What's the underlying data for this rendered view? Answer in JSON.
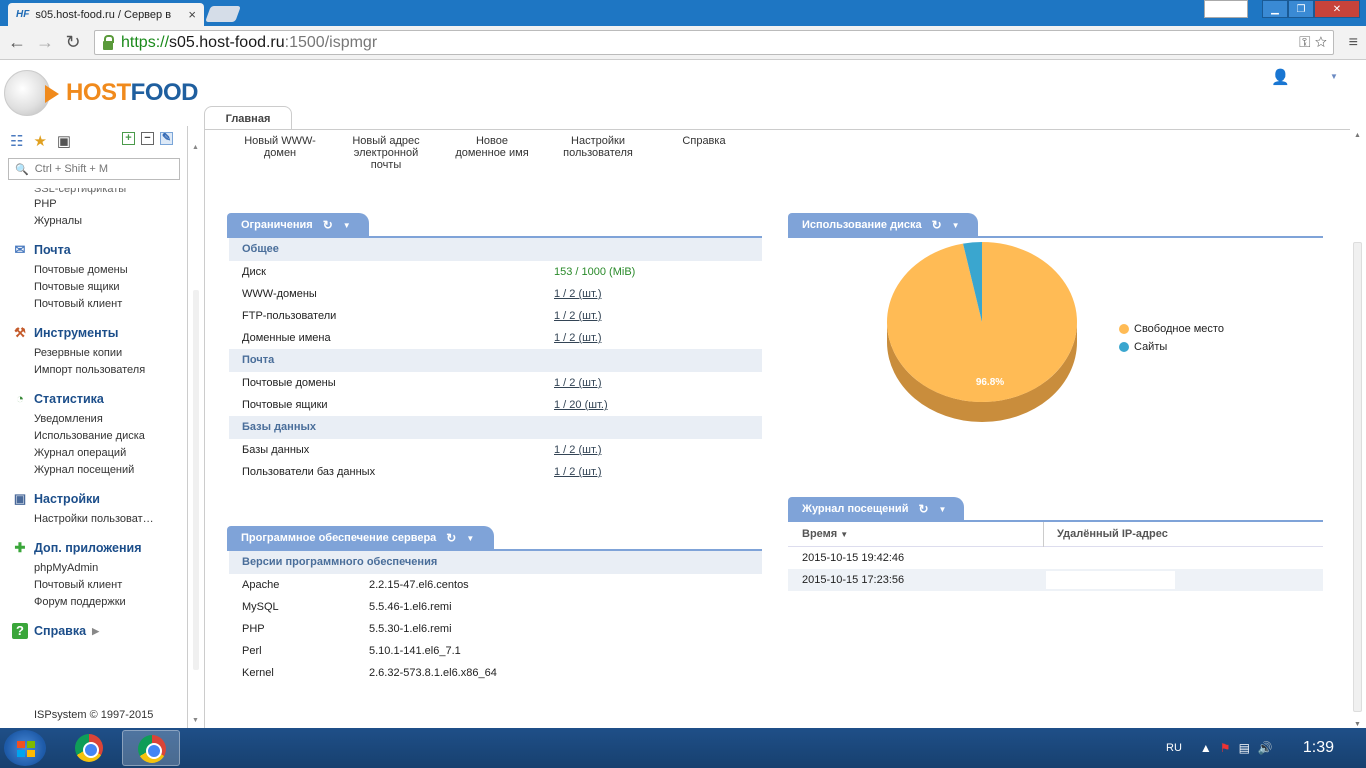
{
  "browser": {
    "tab_title": "s05.host-food.ru / Сервер в",
    "tab_favicon": "HF",
    "url_proto": "https://",
    "url_host": "s05.host-food.ru",
    "url_path": ":1500/ispmgr"
  },
  "header": {
    "logo_host": "HOST",
    "logo_food": "FOOD"
  },
  "sidebar": {
    "search_placeholder": "Ctrl + Shift + M",
    "top_cut_item": "SSL-сертификаты",
    "top_items": [
      "PHP",
      "Журналы"
    ],
    "groups": [
      {
        "label": "Почта",
        "icon": "mail-icon",
        "items": [
          "Почтовые домены",
          "Почтовые ящики",
          "Почтовый клиент"
        ]
      },
      {
        "label": "Инструменты",
        "icon": "tools-icon",
        "items": [
          "Резервные копии",
          "Импорт пользователя"
        ]
      },
      {
        "label": "Статистика",
        "icon": "statistics-icon",
        "items": [
          "Уведомления",
          "Использование диска",
          "Журнал операций",
          "Журнал посещений"
        ]
      },
      {
        "label": "Настройки",
        "icon": "settings-icon",
        "items": [
          "Настройки пользоват…"
        ]
      },
      {
        "label": "Доп. приложения",
        "icon": "plus-icon",
        "items": [
          "phpMyAdmin",
          "Почтовый клиент",
          "Форум поддержки"
        ]
      },
      {
        "label": "Справка",
        "icon": "help-icon",
        "items": []
      }
    ],
    "copyright": "ISPsystem © 1997-2015"
  },
  "main": {
    "tab": "Главная",
    "quick": [
      {
        "line1": "Новый WWW-",
        "line2": "домен",
        "line3": ""
      },
      {
        "line1": "Новый адрес",
        "line2": "электронной",
        "line3": "почты"
      },
      {
        "line1": "Новое",
        "line2": "доменное имя",
        "line3": ""
      },
      {
        "line1": "Настройки",
        "line2": "пользователя",
        "line3": ""
      },
      {
        "line1": "Справка",
        "line2": "",
        "line3": ""
      }
    ],
    "limits": {
      "title": "Ограничения",
      "sections": [
        {
          "name": "Общее",
          "rows": [
            {
              "k": "Диск",
              "v": "153 / 1000 (MiB)",
              "green": true
            },
            {
              "k": "WWW-домены",
              "v": "1 / 2 (шт.)"
            },
            {
              "k": "FTP-пользователи",
              "v": "1 / 2 (шт.)"
            },
            {
              "k": "Доменные имена",
              "v": "1 / 2 (шт.)"
            }
          ]
        },
        {
          "name": "Почта",
          "rows": [
            {
              "k": "Почтовые домены",
              "v": "1 / 2 (шт.)"
            },
            {
              "k": "Почтовые ящики",
              "v": "1 / 20 (шт.)"
            }
          ]
        },
        {
          "name": "Базы данных",
          "rows": [
            {
              "k": "Базы данных",
              "v": "1 / 2 (шт.)"
            },
            {
              "k": "Пользователи баз данных",
              "v": "1 / 2 (шт.)"
            }
          ]
        }
      ]
    },
    "software": {
      "title": "Программное обеспечение сервера",
      "section": "Версии программного обеспечения",
      "rows": [
        {
          "k": "Apache",
          "v": "2.2.15-47.el6.centos"
        },
        {
          "k": "MySQL",
          "v": "5.5.46-1.el6.remi"
        },
        {
          "k": "PHP",
          "v": "5.5.30-1.el6.remi"
        },
        {
          "k": "Perl",
          "v": "5.10.1-141.el6_7.1"
        },
        {
          "k": "Kernel",
          "v": "2.6.32-573.8.1.el6.x86_64"
        }
      ]
    },
    "disk": {
      "title": "Использование диска",
      "slice_label": "96.8%",
      "legend": [
        {
          "label": "Свободное место",
          "color": "#ffbb55"
        },
        {
          "label": "Сайты",
          "color": "#3aa6cf"
        }
      ]
    },
    "visits": {
      "title": "Журнал посещений",
      "col_time": "Время",
      "col_ip": "Удалённый IP-адрес",
      "rows": [
        {
          "time": "2015-10-15 19:42:46",
          "ip": ""
        },
        {
          "time": "2015-10-15 17:23:56",
          "ip": ""
        }
      ]
    }
  },
  "chart_data": {
    "type": "pie",
    "title": "",
    "categories": [
      "Свободное место",
      "Сайты"
    ],
    "values": [
      96.8,
      3.2
    ],
    "colors": [
      "#ffbb55",
      "#3aa6cf"
    ],
    "legend_position": "right"
  },
  "taskbar": {
    "lang": "RU",
    "time": "1:39"
  }
}
